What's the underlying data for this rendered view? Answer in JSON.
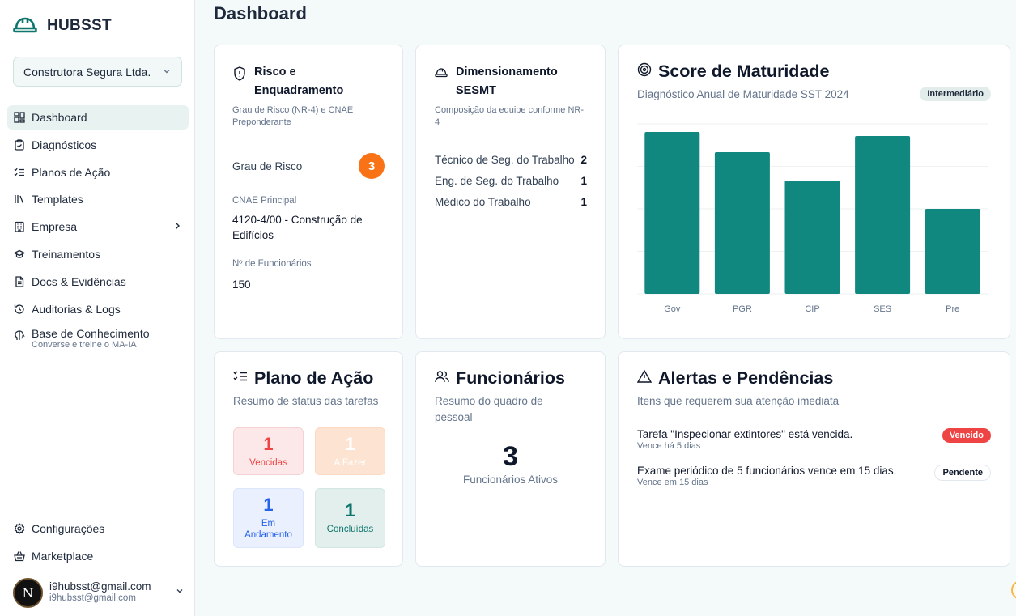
{
  "app": {
    "name": "HUBSST"
  },
  "company_select": {
    "value": "Construtora Segura Ltda."
  },
  "sidebar": {
    "items": [
      {
        "label": "Dashboard",
        "icon": "dashboard-icon"
      },
      {
        "label": "Diagnósticos",
        "icon": "clipboard-check-icon"
      },
      {
        "label": "Planos de Ação",
        "icon": "list-checks-icon"
      },
      {
        "label": "Templates",
        "icon": "library-icon"
      },
      {
        "label": "Empresa",
        "icon": "building-icon"
      },
      {
        "label": "Treinamentos",
        "icon": "graduation-cap-icon"
      },
      {
        "label": "Docs & Evidências",
        "icon": "file-text-icon"
      },
      {
        "label": "Auditorias & Logs",
        "icon": "history-icon"
      },
      {
        "label": "Base de Conhecimento",
        "sub": "Converse e treine o MA-IA",
        "icon": "brain-icon"
      }
    ],
    "bottom": [
      {
        "label": "Configurações",
        "icon": "gear-icon"
      },
      {
        "label": "Marketplace",
        "icon": "basket-icon"
      }
    ]
  },
  "user": {
    "initial": "N",
    "name": "i9hubsst@gmail.com",
    "email": "i9hubsst@gmail.com"
  },
  "page": {
    "title": "Dashboard"
  },
  "risk_card": {
    "title": "Risco e Enquadramento",
    "subtitle": "Grau de Risco (NR-4) e CNAE Preponderante",
    "grau_label": "Grau de Risco",
    "grau_value": "3",
    "cnae_label": "CNAE Principal",
    "cnae_value": "4120-4/00 - Construção de Edifícios",
    "func_label": "Nº de Funcionários",
    "func_value": "150"
  },
  "sesmt_card": {
    "title": "Dimensionamento SESMT",
    "subtitle": "Composição da equipe conforme NR-4",
    "rows": [
      {
        "label": "Técnico de Seg. do Trabalho",
        "value": "2"
      },
      {
        "label": "Eng. de Seg. do Trabalho",
        "value": "1"
      },
      {
        "label": "Médico do Trabalho",
        "value": "1"
      }
    ]
  },
  "maturity_card": {
    "title": "Score de Maturidade",
    "subtitle": "Diagnóstico Anual de Maturidade SST 2024",
    "badge": "Intermediário"
  },
  "chart_data": {
    "type": "bar",
    "categories": [
      "Gov",
      "PGR",
      "CIP",
      "SES",
      "Pre"
    ],
    "values": [
      4.0,
      3.5,
      2.8,
      3.9,
      2.1
    ],
    "ylim": [
      0,
      4.2
    ],
    "grid": true,
    "bar_color": "#10877f"
  },
  "plan_card": {
    "title": "Plano de Ação",
    "subtitle": "Resumo de status das tarefas",
    "tiles": [
      {
        "num": "1",
        "label": "Vencidas"
      },
      {
        "num": "1",
        "label": "A Fazer"
      },
      {
        "num": "1",
        "label": "Em Andamento"
      },
      {
        "num": "1",
        "label": "Concluídas"
      }
    ]
  },
  "employees_card": {
    "title": "Funcionários",
    "subtitle": "Resumo do quadro de pessoal",
    "count": "3",
    "count_label": "Funcionários Ativos"
  },
  "alerts_card": {
    "title": "Alertas e Pendências",
    "subtitle": "Itens que requerem sua atenção imediata",
    "items": [
      {
        "text": "Tarefa \"Inspecionar extintores\" está vencida.",
        "sub": "Vence há 5 dias",
        "badge": "Vencido"
      },
      {
        "text": "Exame periódico de 5 funcionários vence em 15 dias.",
        "sub": "Vence em 15 dias",
        "badge": "Pendente"
      }
    ]
  },
  "colors": {
    "brand": "#0f766e",
    "accent_teal": "#10877f",
    "orange": "#f97316",
    "red": "#ef4444"
  }
}
